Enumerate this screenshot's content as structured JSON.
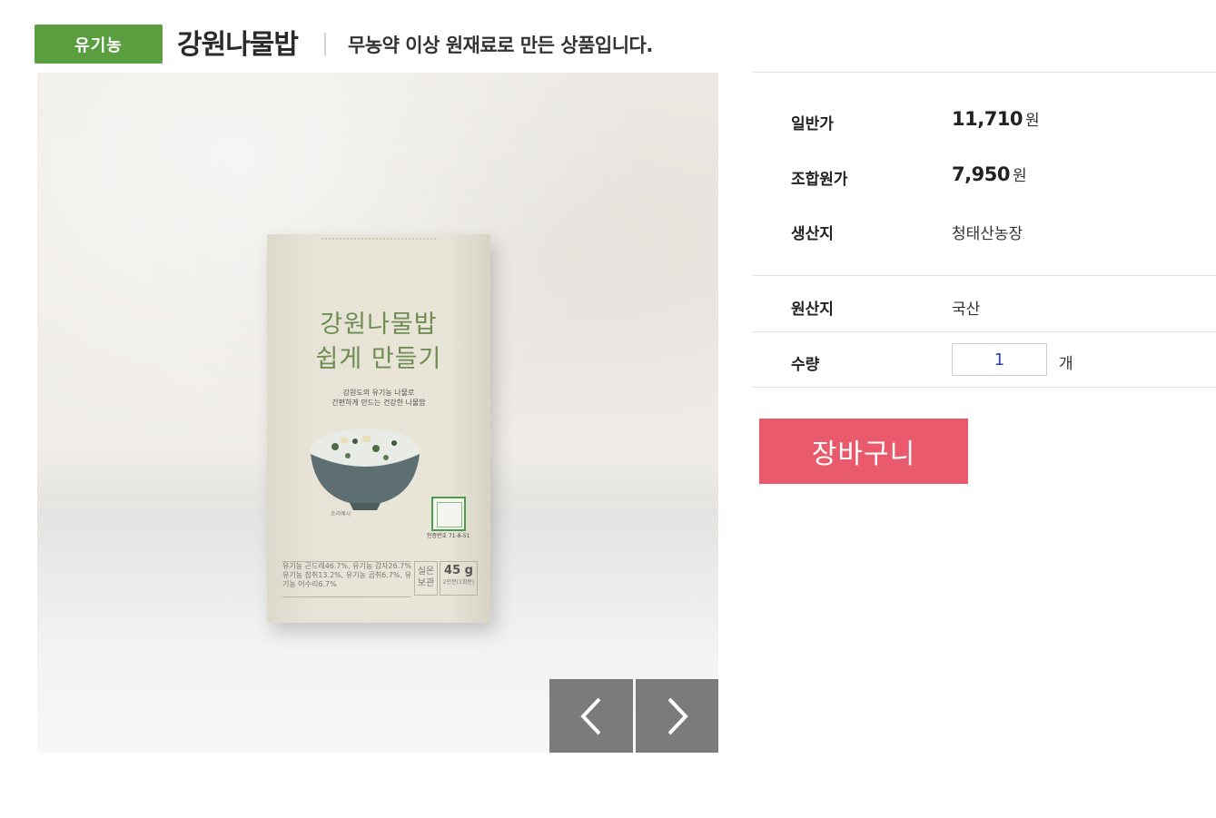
{
  "header": {
    "badge": "유기농",
    "title": "강원나물밥",
    "subtitle": "무농약 이상 원재료로 만든 상품입니다."
  },
  "product_image": {
    "box_title_line1": "강원나물밥",
    "box_title_line2": "쉽게 만들기",
    "box_desc_line1": "강원도의 유기농 나물로",
    "box_desc_line2": "간편하게 만드는 건강한 나물밥",
    "serve_note": "조리예시",
    "cert_number": "인증번호 71-8-51",
    "ingredients": "유기농 곤드레46.7%, 유기농 감자26.7% 유기농 참취13.2%, 유기농 곰취6.7%, 유기농 어수리6.7%",
    "storage": "실온 보관",
    "weight": "45 g",
    "weight_sub": "2인분(1회분)"
  },
  "nav": {
    "prev_icon": "chevron-left-icon",
    "next_icon": "chevron-right-icon"
  },
  "info": {
    "regular_price_label": "일반가",
    "regular_price_value": "11,710",
    "member_price_label": "조합원가",
    "member_price_value": "7,950",
    "currency": "원",
    "producer_label": "생산지",
    "producer_value": "청태산농장",
    "origin_label": "원산지",
    "origin_value": "국산",
    "quantity_label": "수량",
    "quantity_value": "1",
    "quantity_unit": "개"
  },
  "actions": {
    "cart_label": "장바구니"
  },
  "colors": {
    "badge_green": "#5a9e3f",
    "cart_pink": "#e85a6c",
    "nav_gray": "#7b7b7b"
  }
}
